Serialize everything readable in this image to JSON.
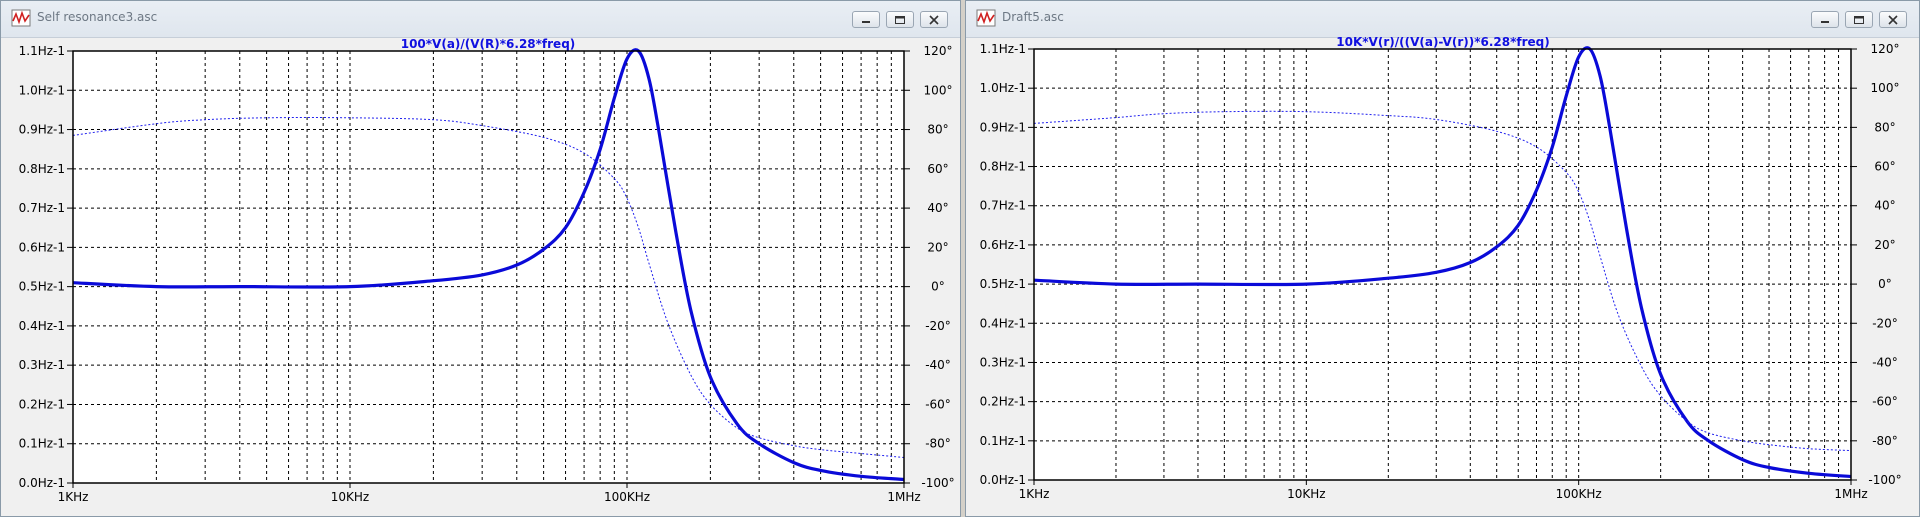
{
  "windows": [
    {
      "title": "Self resonance3.asc",
      "expression": "100*V(a)/(V(R)*6.28*freq)"
    },
    {
      "title": "Draft5.asc",
      "expression": "10K*V(r)/((V(a)-V(r))*6.28*freq)"
    }
  ],
  "chart_data": [
    {
      "type": "line",
      "title": "100*V(a)/(V(R)*6.28*freq)",
      "x_scale": "log",
      "xlim": [
        1000,
        1000000
      ],
      "x_ticks": [
        "1KHz",
        "10KHz",
        "100KHz",
        "1MHz"
      ],
      "y_left_lim": [
        0,
        1.1
      ],
      "y_left_ticks": [
        "0.0Hz-1",
        "0.1Hz-1",
        "0.2Hz-1",
        "0.3Hz-1",
        "0.4Hz-1",
        "0.5Hz-1",
        "0.6Hz-1",
        "0.7Hz-1",
        "0.8Hz-1",
        "0.9Hz-1",
        "1.0Hz-1",
        "1.1Hz-1"
      ],
      "y_right_lim": [
        -100,
        120
      ],
      "y_right_ticks": [
        "-100°",
        "-80°",
        "-60°",
        "-40°",
        "-20°",
        "0°",
        "20°",
        "40°",
        "60°",
        "80°",
        "100°",
        "120°"
      ],
      "grid": true,
      "series": [
        {
          "axis": "left",
          "style": "solid-thick",
          "x": [
            1000,
            2000,
            4000,
            10000,
            20000,
            30000,
            40000,
            50000,
            60000,
            70000,
            80000,
            90000,
            100000,
            110000,
            120000,
            130000,
            150000,
            170000,
            200000,
            250000,
            300000,
            400000,
            500000,
            700000,
            1000000
          ],
          "y": [
            0.51,
            0.5,
            0.5,
            0.5,
            0.515,
            0.53,
            0.555,
            0.595,
            0.65,
            0.74,
            0.85,
            0.98,
            1.08,
            1.1,
            1.03,
            0.9,
            0.64,
            0.44,
            0.27,
            0.15,
            0.1,
            0.052,
            0.032,
            0.017,
            0.009
          ]
        },
        {
          "axis": "right",
          "style": "dotted",
          "x": [
            1000,
            2000,
            3000,
            5000,
            10000,
            20000,
            30000,
            50000,
            70000,
            90000,
            100000,
            110000,
            120000,
            140000,
            170000,
            200000,
            250000,
            300000,
            400000,
            500000,
            700000,
            1000000
          ],
          "y": [
            77,
            83,
            85,
            86,
            86,
            85,
            82,
            76,
            68,
            55,
            45,
            30,
            12,
            -18,
            -45,
            -60,
            -72,
            -77,
            -81,
            -83,
            -85,
            -87
          ]
        }
      ]
    },
    {
      "type": "line",
      "title": "10K*V(r)/((V(a)-V(r))*6.28*freq)",
      "x_scale": "log",
      "xlim": [
        1000,
        1000000
      ],
      "x_ticks": [
        "1KHz",
        "10KHz",
        "100KHz",
        "1MHz"
      ],
      "y_left_lim": [
        0,
        1.1
      ],
      "y_left_ticks": [
        "0.0Hz-1",
        "0.1Hz-1",
        "0.2Hz-1",
        "0.3Hz-1",
        "0.4Hz-1",
        "0.5Hz-1",
        "0.6Hz-1",
        "0.7Hz-1",
        "0.8Hz-1",
        "0.9Hz-1",
        "1.0Hz-1",
        "1.1Hz-1"
      ],
      "y_right_lim": [
        -100,
        120
      ],
      "y_right_ticks": [
        "-100°",
        "-80°",
        "-60°",
        "-40°",
        "-20°",
        "0°",
        "20°",
        "40°",
        "60°",
        "80°",
        "100°",
        "120°"
      ],
      "grid": true,
      "series": [
        {
          "axis": "left",
          "style": "solid-thick",
          "x": [
            1000,
            2000,
            4000,
            10000,
            20000,
            30000,
            40000,
            50000,
            60000,
            70000,
            80000,
            90000,
            100000,
            110000,
            120000,
            130000,
            150000,
            170000,
            200000,
            250000,
            300000,
            400000,
            500000,
            700000,
            1000000
          ],
          "y": [
            0.51,
            0.5,
            0.5,
            0.5,
            0.515,
            0.53,
            0.555,
            0.595,
            0.65,
            0.74,
            0.85,
            0.98,
            1.08,
            1.1,
            1.03,
            0.9,
            0.64,
            0.44,
            0.27,
            0.15,
            0.1,
            0.052,
            0.032,
            0.017,
            0.009
          ]
        },
        {
          "axis": "right",
          "style": "dotted",
          "x": [
            1000,
            2000,
            3000,
            5000,
            10000,
            20000,
            30000,
            50000,
            70000,
            90000,
            100000,
            110000,
            120000,
            140000,
            170000,
            200000,
            250000,
            300000,
            400000,
            500000,
            700000,
            1000000
          ],
          "y": [
            82,
            85,
            87,
            88,
            88,
            86,
            84,
            78,
            70,
            57,
            47,
            32,
            14,
            -16,
            -42,
            -57,
            -70,
            -76,
            -80,
            -82,
            -84,
            -85
          ]
        }
      ]
    }
  ]
}
